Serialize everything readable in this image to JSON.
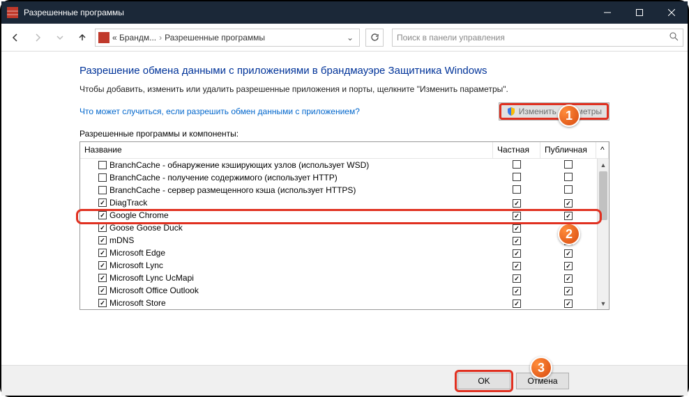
{
  "window": {
    "title": "Разрешенные программы"
  },
  "nav": {
    "crumb1": "« Брандм...",
    "crumb2": "Разрешенные программы",
    "searchPlaceholder": "Поиск в панели управления"
  },
  "page": {
    "heading": "Разрешение обмена данными с приложениями в брандмауэре Защитника Windows",
    "desc": "Чтобы добавить, изменить или удалить разрешенные приложения и порты, щелкните \"Изменить параметры\".",
    "riskLink": "Что может случиться, если разрешить обмен данными с приложением?",
    "changeBtn": "Изменить параметры",
    "tableLabel": "Разрешенные программы и компоненты:",
    "colName": "Название",
    "colPrivate": "Частная",
    "colPublic": "Публичная"
  },
  "rows": [
    {
      "name": "BranchCache - обнаружение кэширующих узлов (использует WSD)",
      "enabled": false,
      "private": false,
      "public": false
    },
    {
      "name": "BranchCache - получение содержимого (использует HTTP)",
      "enabled": false,
      "private": false,
      "public": false
    },
    {
      "name": "BranchCache - сервер размещенного кэша (использует HTTPS)",
      "enabled": false,
      "private": false,
      "public": false
    },
    {
      "name": "DiagTrack",
      "enabled": true,
      "private": true,
      "public": true
    },
    {
      "name": "Google Chrome",
      "enabled": true,
      "private": true,
      "public": true
    },
    {
      "name": "Goose Goose Duck",
      "enabled": true,
      "private": true,
      "public": true
    },
    {
      "name": "mDNS",
      "enabled": true,
      "private": true,
      "public": true
    },
    {
      "name": "Microsoft Edge",
      "enabled": true,
      "private": true,
      "public": true
    },
    {
      "name": "Microsoft Lync",
      "enabled": true,
      "private": true,
      "public": true
    },
    {
      "name": "Microsoft Lync UcMapi",
      "enabled": true,
      "private": true,
      "public": true
    },
    {
      "name": "Microsoft Office Outlook",
      "enabled": true,
      "private": true,
      "public": true
    },
    {
      "name": "Microsoft Store",
      "enabled": true,
      "private": true,
      "public": true
    }
  ],
  "footer": {
    "ok": "OK",
    "cancel": "Отмена"
  },
  "badges": {
    "b1": "1",
    "b2": "2",
    "b3": "3"
  }
}
